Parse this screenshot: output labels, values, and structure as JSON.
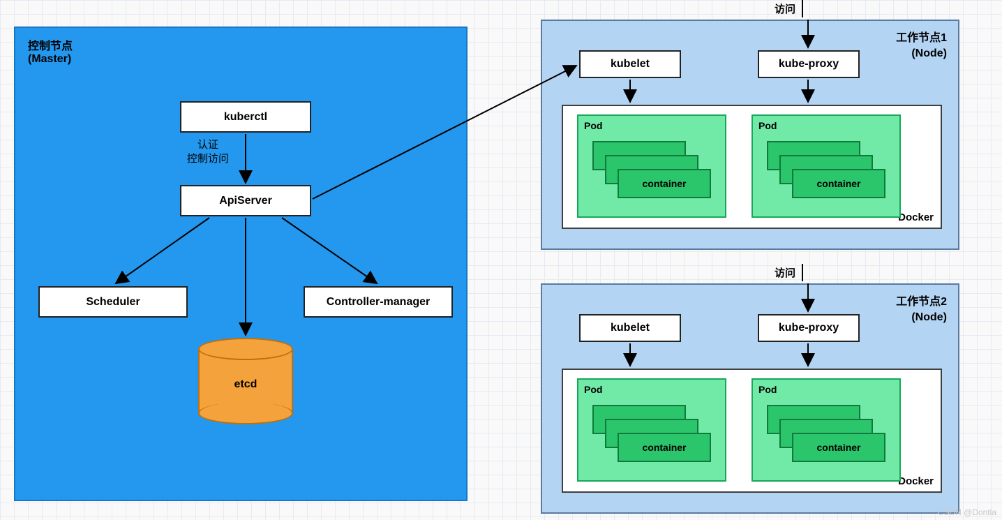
{
  "master": {
    "title_line1": "控制节点",
    "title_line2": "(Master)",
    "kuberctl": "kuberctl",
    "auth_line1": "认证",
    "auth_line2": "控制访问",
    "apiserver": "ApiServer",
    "scheduler": "Scheduler",
    "controller_manager": "Controller-manager",
    "etcd": "etcd"
  },
  "worker1": {
    "access": "访问",
    "title_line1": "工作节点1",
    "title_line2": "(Node)",
    "kubelet": "kubelet",
    "kube_proxy": "kube-proxy",
    "docker": "Docker",
    "pod_label": "Pod",
    "container": "container"
  },
  "worker2": {
    "access": "访问",
    "title_line1": "工作节点2",
    "title_line2": "(Node)",
    "kubelet": "kubelet",
    "kube_proxy": "kube-proxy",
    "docker": "Docker",
    "pod_label": "Pod",
    "container": "container"
  },
  "watermark": "CSDN @Dontla"
}
